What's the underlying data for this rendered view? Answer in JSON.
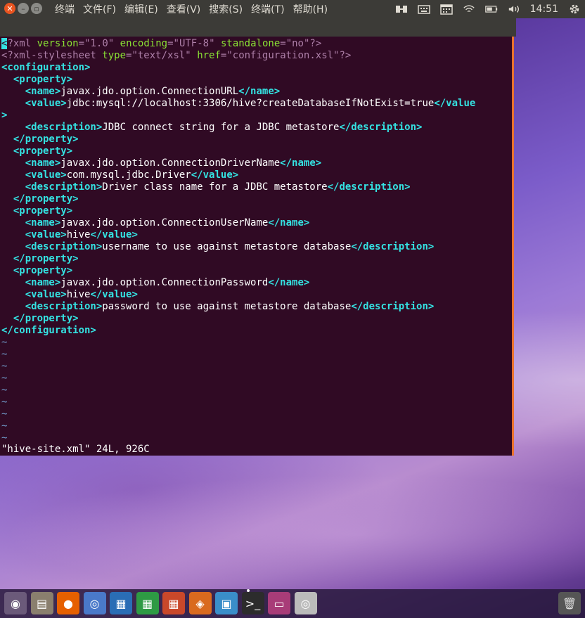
{
  "menu": {
    "items": [
      "终端",
      "文件(F)",
      "编辑(E)",
      "查看(V)",
      "搜索(S)",
      "终端(T)",
      "帮助(H)"
    ]
  },
  "tray": {
    "time": "14:51"
  },
  "editor": {
    "lines": [
      {
        "segs": [
          [
            "cursor",
            "<"
          ],
          [
            "decl",
            "?xml "
          ],
          [
            "attr",
            "version"
          ],
          [
            "decl",
            "="
          ],
          [
            "str",
            "\"1.0\""
          ],
          [
            "decl",
            " "
          ],
          [
            "attr",
            "encoding"
          ],
          [
            "decl",
            "="
          ],
          [
            "str",
            "\"UTF-8\""
          ],
          [
            "decl",
            " "
          ],
          [
            "attr",
            "standalone"
          ],
          [
            "decl",
            "="
          ],
          [
            "str",
            "\"no\""
          ],
          [
            "decl",
            "?>"
          ]
        ]
      },
      {
        "segs": [
          [
            "decl",
            "<?xml-stylesheet "
          ],
          [
            "attr",
            "type"
          ],
          [
            "decl",
            "="
          ],
          [
            "str",
            "\"text/xsl\""
          ],
          [
            "decl",
            " "
          ],
          [
            "attr",
            "href"
          ],
          [
            "decl",
            "="
          ],
          [
            "str",
            "\"configuration.xsl\""
          ],
          [
            "decl",
            "?>"
          ]
        ]
      },
      {
        "segs": [
          [
            "tag",
            "<configuration>"
          ]
        ]
      },
      {
        "segs": [
          [
            "txt",
            "  "
          ],
          [
            "tag",
            "<property>"
          ]
        ]
      },
      {
        "segs": [
          [
            "txt",
            "    "
          ],
          [
            "tag",
            "<name>"
          ],
          [
            "txt",
            "javax.jdo.option.ConnectionURL"
          ],
          [
            "tag",
            "</name>"
          ]
        ]
      },
      {
        "segs": [
          [
            "txt",
            "    "
          ],
          [
            "tag",
            "<value>"
          ],
          [
            "txt",
            "jdbc:mysql://localhost:3306/hive?createDatabaseIfNotExist=true"
          ],
          [
            "tag",
            "</value"
          ]
        ]
      },
      {
        "segs": [
          [
            "tag",
            ">"
          ]
        ]
      },
      {
        "segs": [
          [
            "txt",
            "    "
          ],
          [
            "tag",
            "<description>"
          ],
          [
            "txt",
            "JDBC connect string for a JDBC metastore"
          ],
          [
            "tag",
            "</description>"
          ]
        ]
      },
      {
        "segs": [
          [
            "txt",
            "  "
          ],
          [
            "tag",
            "</property>"
          ]
        ]
      },
      {
        "segs": [
          [
            "txt",
            "  "
          ],
          [
            "tag",
            "<property>"
          ]
        ]
      },
      {
        "segs": [
          [
            "txt",
            "    "
          ],
          [
            "tag",
            "<name>"
          ],
          [
            "txt",
            "javax.jdo.option.ConnectionDriverName"
          ],
          [
            "tag",
            "</name>"
          ]
        ]
      },
      {
        "segs": [
          [
            "txt",
            "    "
          ],
          [
            "tag",
            "<value>"
          ],
          [
            "txt",
            "com.mysql.jdbc.Driver"
          ],
          [
            "tag",
            "</value>"
          ]
        ]
      },
      {
        "segs": [
          [
            "txt",
            "    "
          ],
          [
            "tag",
            "<description>"
          ],
          [
            "txt",
            "Driver class name for a JDBC metastore"
          ],
          [
            "tag",
            "</description>"
          ]
        ]
      },
      {
        "segs": [
          [
            "txt",
            "  "
          ],
          [
            "tag",
            "</property>"
          ]
        ]
      },
      {
        "segs": [
          [
            "txt",
            "  "
          ],
          [
            "tag",
            "<property>"
          ]
        ]
      },
      {
        "segs": [
          [
            "txt",
            "    "
          ],
          [
            "tag",
            "<name>"
          ],
          [
            "txt",
            "javax.jdo.option.ConnectionUserName"
          ],
          [
            "tag",
            "</name>"
          ]
        ]
      },
      {
        "segs": [
          [
            "txt",
            "    "
          ],
          [
            "tag",
            "<value>"
          ],
          [
            "txt",
            "hive"
          ],
          [
            "tag",
            "</value>"
          ]
        ]
      },
      {
        "segs": [
          [
            "txt",
            "    "
          ],
          [
            "tag",
            "<description>"
          ],
          [
            "txt",
            "username to use against metastore database"
          ],
          [
            "tag",
            "</description>"
          ]
        ]
      },
      {
        "segs": [
          [
            "txt",
            "  "
          ],
          [
            "tag",
            "</property>"
          ]
        ]
      },
      {
        "segs": [
          [
            "txt",
            "  "
          ],
          [
            "tag",
            "<property>"
          ]
        ]
      },
      {
        "segs": [
          [
            "txt",
            "    "
          ],
          [
            "tag",
            "<name>"
          ],
          [
            "txt",
            "javax.jdo.option.ConnectionPassword"
          ],
          [
            "tag",
            "</name>"
          ]
        ]
      },
      {
        "segs": [
          [
            "txt",
            "    "
          ],
          [
            "tag",
            "<value>"
          ],
          [
            "txt",
            "hive"
          ],
          [
            "tag",
            "</value>"
          ]
        ]
      },
      {
        "segs": [
          [
            "txt",
            "    "
          ],
          [
            "tag",
            "<description>"
          ],
          [
            "txt",
            "password to use against metastore database"
          ],
          [
            "tag",
            "</description>"
          ]
        ]
      },
      {
        "segs": [
          [
            "txt",
            "  "
          ],
          [
            "tag",
            "</property>"
          ]
        ]
      },
      {
        "segs": [
          [
            "tag",
            "</configuration>"
          ]
        ]
      },
      {
        "segs": [
          [
            "tilde",
            "~"
          ]
        ]
      },
      {
        "segs": [
          [
            "tilde",
            "~"
          ]
        ]
      },
      {
        "segs": [
          [
            "tilde",
            "~"
          ]
        ]
      },
      {
        "segs": [
          [
            "tilde",
            "~"
          ]
        ]
      },
      {
        "segs": [
          [
            "tilde",
            "~"
          ]
        ]
      },
      {
        "segs": [
          [
            "tilde",
            "~"
          ]
        ]
      },
      {
        "segs": [
          [
            "tilde",
            "~"
          ]
        ]
      },
      {
        "segs": [
          [
            "tilde",
            "~"
          ]
        ]
      },
      {
        "segs": [
          [
            "tilde",
            "~"
          ]
        ]
      }
    ],
    "status": "\"hive-site.xml\" 24L, 926C"
  },
  "dock": {
    "items": [
      "ubuntu-dash",
      "files",
      "firefox",
      "chromium",
      "writer",
      "calc",
      "impress",
      "software-center",
      "image-viewer",
      "terminal",
      "settings-window",
      "disc"
    ]
  }
}
